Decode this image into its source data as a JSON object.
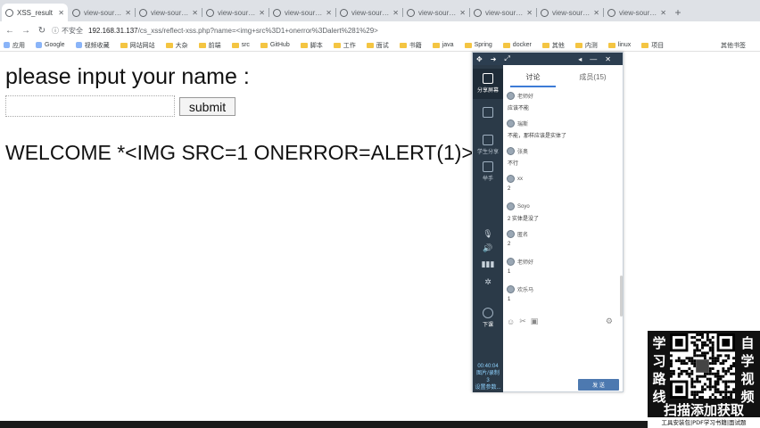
{
  "browser": {
    "tabs": [
      {
        "title": "XSS_result",
        "active": true
      },
      {
        "title": "view-source:",
        "active": false
      },
      {
        "title": "view-source:",
        "active": false
      },
      {
        "title": "view-source:",
        "active": false
      },
      {
        "title": "view-source:",
        "active": false
      },
      {
        "title": "view-source:",
        "active": false
      },
      {
        "title": "view-source:",
        "active": false
      },
      {
        "title": "view-source:",
        "active": false
      },
      {
        "title": "view-source:",
        "active": false
      },
      {
        "title": "view-source:",
        "active": false
      }
    ],
    "new_tab": "+",
    "address": {
      "security_label": "不安全",
      "host": "192.168.31.137",
      "path": "/cs_xss/reflect-xss.php?name=<img+src%3D1+onerror%3Dalert%281%29>"
    },
    "bookmarks": [
      "应用",
      "Google",
      "视频收藏",
      "网站网站",
      "大杂",
      "前端",
      "src",
      "GitHub",
      "脚本",
      "工作",
      "面试",
      "书籍",
      "java",
      "Spring",
      "docker",
      "其他",
      "内测",
      "linux",
      "项目"
    ],
    "bookmarks_overflow": "其他书签"
  },
  "page": {
    "prompt": "please input your name :",
    "submit_label": "submit",
    "welcome": "WELCOME *<IMG SRC=1 ONERROR=ALERT(1)>*"
  },
  "live": {
    "sidebar": [
      {
        "label": "分享屏幕"
      },
      {
        "label": ""
      },
      {
        "label": "学生分享"
      },
      {
        "label": "举手"
      }
    ],
    "class_end": "下课",
    "timer": "00:40:04",
    "timer_sub1": "图片/录制",
    "timer_sub2": "3",
    "timer_sub3": "设置参数...",
    "tabs": [
      "讨论",
      "成员(15)"
    ],
    "messages": [
      {
        "user": "老师好",
        "text": "应该不能"
      },
      {
        "user": "瑞斯",
        "text": "不能，那样应该是实体了"
      },
      {
        "user": "张奥",
        "text": "不行"
      },
      {
        "user": "xx",
        "text": "2"
      },
      {
        "user": "Soyo",
        "text": "2 实体是没了"
      },
      {
        "user": "匿名",
        "text": "2"
      },
      {
        "user": "老师好",
        "text": "1"
      },
      {
        "user": "欢乐马",
        "text": "1"
      }
    ],
    "send_label": "发 送"
  },
  "promo": {
    "left_text": [
      "学",
      "习",
      "路",
      "线"
    ],
    "right_text": [
      "自",
      "学",
      "视",
      "频"
    ],
    "scan_text": "扫描添加获取",
    "footer": "工具安装包|PDF学习书籍|面试题"
  }
}
